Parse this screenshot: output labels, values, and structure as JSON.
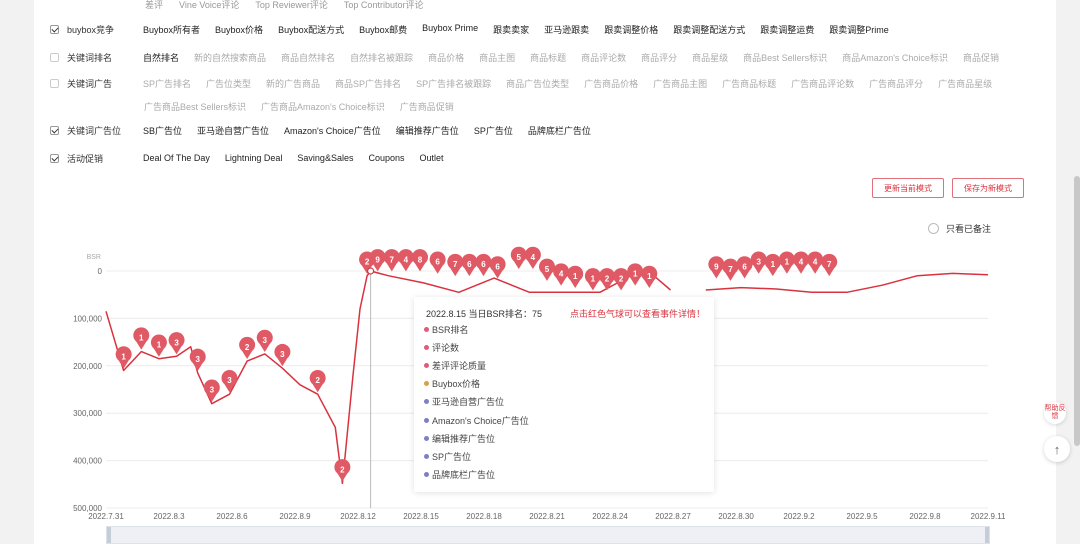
{
  "top_row": [
    "差评",
    "Vine Voice评论",
    "Top Reviewer评论",
    "Top Contributor评论"
  ],
  "rows": [
    {
      "label": "buybox竞争",
      "checked": true,
      "style": "dark",
      "options": [
        "Buybox所有者",
        "Buybox价格",
        "Buybox配送方式",
        "Buybox邮费",
        "Buybox Prime",
        "跟卖卖家",
        "亚马逊跟卖",
        "跟卖调整价格",
        "跟卖调整配送方式",
        "跟卖调整运费",
        "跟卖调整Prime"
      ]
    },
    {
      "label": "关键词排名",
      "checked": false,
      "style": "mixed",
      "options": [
        "自然排名",
        "新的自然搜索商品",
        "商品自然排名",
        "自然排名被跟踪",
        "商品价格",
        "商品主图",
        "商品标题",
        "商品评论数",
        "商品评分",
        "商品星级",
        "商品Best Sellers标识",
        "商品Amazon's Choice标识",
        "商品促销"
      ]
    },
    {
      "label": "关键词广告",
      "checked": false,
      "style": "muted",
      "options": [
        "SP广告排名",
        "广告位类型",
        "新的广告商品",
        "商品SP广告排名",
        "SP广告排名被跟踪",
        "商品广告位类型",
        "广告商品价格",
        "广告商品主图",
        "广告商品标题",
        "广告商品评论数",
        "广告商品评分",
        "广告商品星级"
      ],
      "options2": [
        "广告商品Best Sellers标识",
        "广告商品Amazon's Choice标识",
        "广告商品促销"
      ]
    },
    {
      "label": "关键词广告位",
      "checked": true,
      "style": "dark",
      "options": [
        "SB广告位",
        "亚马逊自营广告位",
        "Amazon's Choice广告位",
        "编辑推荐广告位",
        "SP广告位",
        "品牌底栏广告位"
      ]
    },
    {
      "label": "活动促销",
      "checked": true,
      "style": "dark",
      "options": [
        "Deal Of The Day",
        "Lightning Deal",
        "Saving&Sales",
        "Coupons",
        "Outlet"
      ]
    }
  ],
  "buttons": {
    "update_current": "更新当前模式",
    "save_new": "保存为新模式"
  },
  "notes_toggle": "只看已备注",
  "help_label": "帮助反馈",
  "chart_data": {
    "type": "line",
    "ylabel": "BSR",
    "y_ticks": [
      "0",
      "100,000",
      "200,000",
      "300,000",
      "400,000",
      "500,000"
    ],
    "ylim": [
      0,
      500000
    ],
    "y_inverted": true,
    "x_ticks": [
      "2022.7.31",
      "2022.8.3",
      "2022.8.6",
      "2022.8.9",
      "2022.8.12",
      "2022.8.15",
      "2022.8.18",
      "2022.8.21",
      "2022.8.24",
      "2022.8.27",
      "2022.8.30",
      "2022.9.2",
      "2022.9.5",
      "2022.9.8",
      "2022.9.11"
    ],
    "line_color": "#d9323f",
    "series": [
      {
        "segment": 1,
        "points": [
          [
            0,
            85000
          ],
          [
            0.5,
            210000
          ],
          [
            1,
            170000
          ],
          [
            1.5,
            185000
          ],
          [
            2,
            180000
          ],
          [
            2.4,
            160000
          ],
          [
            2.6,
            215000
          ],
          [
            3,
            280000
          ],
          [
            3.5,
            260000
          ],
          [
            4,
            190000
          ],
          [
            4.5,
            175000
          ],
          [
            5,
            205000
          ],
          [
            5.5,
            240000
          ],
          [
            6,
            260000
          ],
          [
            6.5,
            330000
          ],
          [
            6.7,
            448000
          ],
          [
            7,
            220000
          ],
          [
            7.2,
            80000
          ],
          [
            7.4,
            10000
          ],
          [
            7.5,
            0
          ]
        ]
      },
      {
        "segment": 2,
        "points": [
          [
            7.5,
            0
          ],
          [
            8,
            10000
          ],
          [
            9,
            25000
          ],
          [
            10,
            45000
          ],
          [
            11,
            15000
          ],
          [
            12,
            45000
          ],
          [
            13,
            45000
          ],
          [
            14,
            45000
          ],
          [
            15,
            5000
          ],
          [
            15.5,
            8000
          ],
          [
            16,
            40000
          ]
        ]
      },
      {
        "segment": 3,
        "points": [
          [
            17,
            40000
          ],
          [
            18,
            35000
          ],
          [
            19,
            38000
          ],
          [
            20,
            45000
          ],
          [
            21,
            45000
          ],
          [
            22,
            30000
          ],
          [
            23,
            10000
          ],
          [
            24,
            5000
          ],
          [
            25,
            8000
          ]
        ]
      }
    ],
    "markers": [
      {
        "x": 0.5,
        "y": 210000,
        "label": "1"
      },
      {
        "x": 1,
        "y": 170000,
        "label": "1"
      },
      {
        "x": 1.5,
        "y": 185000,
        "label": "1"
      },
      {
        "x": 2,
        "y": 180000,
        "label": "3"
      },
      {
        "x": 2.6,
        "y": 215000,
        "label": "3"
      },
      {
        "x": 3,
        "y": 280000,
        "label": "3"
      },
      {
        "x": 3.5,
        "y": 260000,
        "label": "3"
      },
      {
        "x": 4,
        "y": 190000,
        "label": "2"
      },
      {
        "x": 4.5,
        "y": 175000,
        "label": "3"
      },
      {
        "x": 5,
        "y": 205000,
        "label": "3"
      },
      {
        "x": 6,
        "y": 260000,
        "label": "2"
      },
      {
        "x": 6.7,
        "y": 448000,
        "label": "2"
      },
      {
        "x": 7.4,
        "y": 10000,
        "label": "2"
      },
      {
        "x": 7.7,
        "y": 5000,
        "label": "9"
      },
      {
        "x": 8.1,
        "y": 5000,
        "label": "7"
      },
      {
        "x": 8.5,
        "y": 5000,
        "label": "4"
      },
      {
        "x": 8.9,
        "y": 5000,
        "label": "8"
      },
      {
        "x": 9.4,
        "y": 10000,
        "label": "6"
      },
      {
        "x": 9.9,
        "y": 15000,
        "label": "7"
      },
      {
        "x": 10.3,
        "y": 15000,
        "label": "6"
      },
      {
        "x": 10.7,
        "y": 15000,
        "label": "6"
      },
      {
        "x": 11.1,
        "y": 20000,
        "label": "6"
      },
      {
        "x": 11.7,
        "y": 0,
        "label": "5"
      },
      {
        "x": 12.1,
        "y": 0,
        "label": "4"
      },
      {
        "x": 12.5,
        "y": 25000,
        "label": "5"
      },
      {
        "x": 12.9,
        "y": 35000,
        "label": "4"
      },
      {
        "x": 13.3,
        "y": 40000,
        "label": "1"
      },
      {
        "x": 13.8,
        "y": 45000,
        "label": "1"
      },
      {
        "x": 14.2,
        "y": 45000,
        "label": "2"
      },
      {
        "x": 14.6,
        "y": 45000,
        "label": "2"
      },
      {
        "x": 15.0,
        "y": 35000,
        "label": "1"
      },
      {
        "x": 15.4,
        "y": 40000,
        "label": "1"
      },
      {
        "x": 17.3,
        "y": 20000,
        "label": "9"
      },
      {
        "x": 17.7,
        "y": 25000,
        "label": "7"
      },
      {
        "x": 18.1,
        "y": 20000,
        "label": "6"
      },
      {
        "x": 18.5,
        "y": 10000,
        "label": "3"
      },
      {
        "x": 18.9,
        "y": 15000,
        "label": "1"
      },
      {
        "x": 19.3,
        "y": 10000,
        "label": "1"
      },
      {
        "x": 19.7,
        "y": 10000,
        "label": "4"
      },
      {
        "x": 20.1,
        "y": 10000,
        "label": "4"
      },
      {
        "x": 20.5,
        "y": 15000,
        "label": "7"
      }
    ],
    "cursor_date": "2022.8.15"
  },
  "tooltip": {
    "header": "2022.8.15 当日BSR排名：75",
    "hint": "点击红色气球可以查看事件详情！",
    "items": [
      {
        "label": "BSR排名",
        "color": "#e05a7a"
      },
      {
        "label": "评论数",
        "color": "#e05a7a"
      },
      {
        "label": "差评评论质量",
        "color": "#e05a7a"
      },
      {
        "label": "Buybox价格",
        "color": "#d9a04a"
      },
      {
        "label": "亚马逊自营广告位",
        "color": "#7f7fc4"
      },
      {
        "label": "Amazon's Choice广告位",
        "color": "#7f7fc4"
      },
      {
        "label": "编辑推荐广告位",
        "color": "#7f7fc4"
      },
      {
        "label": "SP广告位",
        "color": "#7f7fc4"
      },
      {
        "label": "品牌底栏广告位",
        "color": "#7f7fc4"
      }
    ]
  }
}
